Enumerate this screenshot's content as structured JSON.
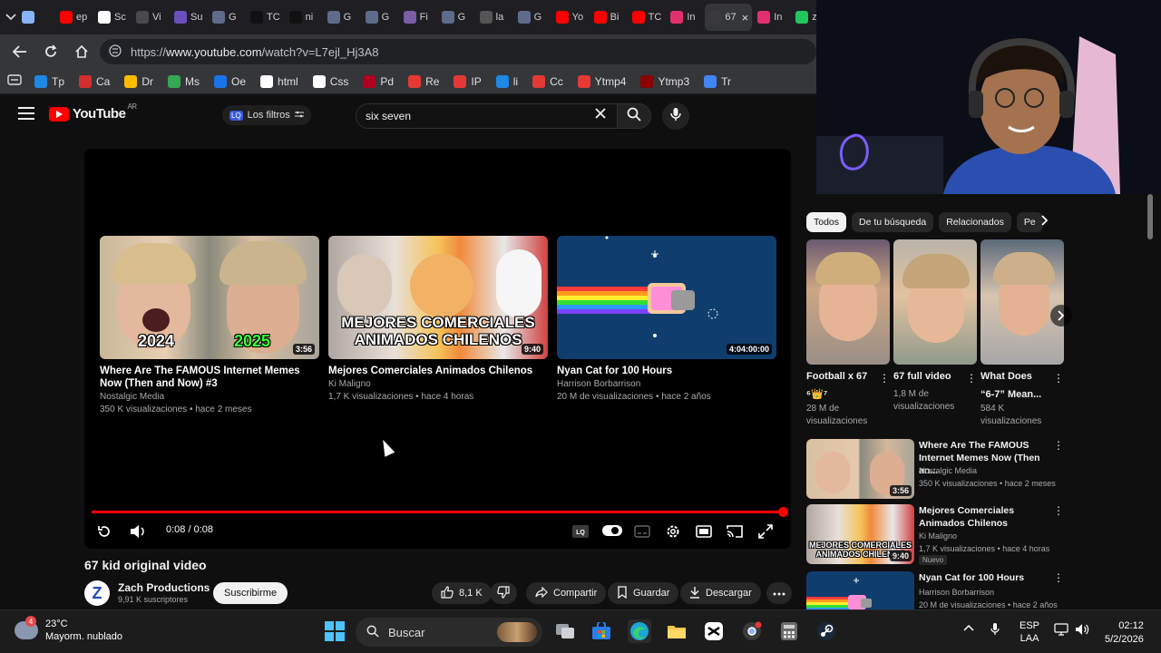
{
  "browser": {
    "tabs": [
      {
        "label": "",
        "color": "#8ab4f8",
        "active": false
      },
      {
        "label": "ep",
        "color": "#ff0000",
        "active": false
      },
      {
        "label": "Sc",
        "color": "#ffffff",
        "active": false
      },
      {
        "label": "Vi",
        "color": "#4a4a4a",
        "active": false
      },
      {
        "label": "Su",
        "color": "#6b4fbb",
        "active": false
      },
      {
        "label": "G",
        "color": "#5f6b8a",
        "active": false
      },
      {
        "label": "TC",
        "color": "#111111",
        "active": false
      },
      {
        "label": "ni",
        "color": "#111111",
        "active": false
      },
      {
        "label": "G",
        "color": "#5f6b8a",
        "active": false
      },
      {
        "label": "G",
        "color": "#5f6b8a",
        "active": false
      },
      {
        "label": "Fi",
        "color": "#7b5ea7",
        "active": false
      },
      {
        "label": "G",
        "color": "#5f6b8a",
        "active": false
      },
      {
        "label": "la",
        "color": "#555555",
        "active": false
      },
      {
        "label": "G",
        "color": "#5f6b8a",
        "active": false
      },
      {
        "label": "Yo",
        "color": "#ff0000",
        "active": false
      },
      {
        "label": "Bi",
        "color": "#ff0000",
        "active": false
      },
      {
        "label": "TC",
        "color": "#ff0000",
        "active": false
      },
      {
        "label": "In",
        "color": "#e1306c",
        "active": false
      },
      {
        "label": "67",
        "color": "#3a3a3a",
        "active": true
      },
      {
        "label": "In",
        "color": "#e1306c",
        "active": false
      },
      {
        "label": "zi",
        "color": "#22c55e",
        "active": false
      }
    ],
    "url_prefix": "https://",
    "url_host": "www.youtube.com",
    "url_path": "/watch?v=L7ejl_Hj3A8",
    "bookmarks": [
      {
        "label": "Tp",
        "color": "#1e88e5"
      },
      {
        "label": "Ca",
        "color": "#d32f2f"
      },
      {
        "label": "Dr",
        "color": "#fbbc04"
      },
      {
        "label": "Ms",
        "color": "#34a853"
      },
      {
        "label": "Oe",
        "color": "#1a73e8"
      },
      {
        "label": "html",
        "color": "#ffffff"
      },
      {
        "label": "Css",
        "color": "#ffffff"
      },
      {
        "label": "Pd",
        "color": "#b00020"
      },
      {
        "label": "Re",
        "color": "#e53935"
      },
      {
        "label": "IP",
        "color": "#e53935"
      },
      {
        "label": "li",
        "color": "#1e88e5"
      },
      {
        "label": "Cc",
        "color": "#e53935"
      },
      {
        "label": "Ytmp4",
        "color": "#e53935"
      },
      {
        "label": "Ytmp3",
        "color": "#8b0000"
      },
      {
        "label": "Tr",
        "color": "#4285f4"
      }
    ]
  },
  "youtube": {
    "logo_text": "YouTube",
    "logo_country": "AR",
    "filters_label": "Los filtros",
    "filters_badge": "LQ",
    "search_query": "six seven",
    "accent": "#ff0000"
  },
  "player": {
    "endcards": [
      {
        "title": "Where Are The FAMOUS Internet Memes Now (Then and Now) #3",
        "channel": "Nostalgic Media",
        "meta": "350 K visualizaciones • hace 2 meses",
        "duration": "3:56",
        "overlay_left": "2024",
        "overlay_right": "2025"
      },
      {
        "title": "Mejores Comerciales Animados Chilenos",
        "channel": "Ki Maligno",
        "meta": "1,7 K visualizaciones • hace 4 horas",
        "duration": "9:40",
        "overlay": "MEJORES COMERCIALES ANIMADOS CHILENOS"
      },
      {
        "title": "Nyan Cat for 100 Hours",
        "channel": "Harrison Borbarrison",
        "meta": "20 M de visualizaciones • hace 2 años",
        "duration": "4:04:00:00"
      }
    ],
    "time": "0:08 / 0:08",
    "progress": 1.0
  },
  "video": {
    "title": "67 kid original video",
    "channel_initial": "Z",
    "channel": "Zach Productions",
    "subscribers": "9,91 K suscriptores",
    "subscribe_label": "Suscribirme",
    "likes": "8,1 K",
    "share_label": "Compartir",
    "save_label": "Guardar",
    "download_label": "Descargar"
  },
  "sidebar": {
    "chips": [
      "Todos",
      "De tu búsqueda",
      "Relacionados",
      "Pe"
    ],
    "shorts": [
      {
        "title": "Football x 67",
        "title2": "⁶👑⁷",
        "views": "28 M de visualizaciones"
      },
      {
        "title": "67 full video",
        "title2": "",
        "views": "1,8 M de visualizaciones"
      },
      {
        "title": "What Does",
        "title2": "“6-7” Mean...",
        "views": "584 K visualizaciones"
      }
    ],
    "recommendations": [
      {
        "title": "Where Are The FAMOUS Internet Memes Now (Then an...",
        "channel": "Nostalgic Media",
        "meta": "350 K visualizaciones • hace 2 meses",
        "duration": "3:56",
        "badge": ""
      },
      {
        "title": "Mejores Comerciales Animados Chilenos",
        "channel": "Ki Maligno",
        "meta": "1,7 K visualizaciones • hace 4 horas",
        "duration": "9:40",
        "badge": "Nuevo"
      },
      {
        "title": "Nyan Cat for 100 Hours",
        "channel": "Harrison Borbarrison",
        "meta": "20 M de visualizaciones • hace 2 años",
        "duration": "",
        "badge": ""
      }
    ]
  },
  "taskbar": {
    "weather_badge": "4",
    "temperature": "23°C",
    "condition": "Mayorm. nublado",
    "search_label": "Buscar",
    "language": "ESP",
    "layout": "LAA",
    "time": "02:12",
    "date": "5/2/2026"
  }
}
